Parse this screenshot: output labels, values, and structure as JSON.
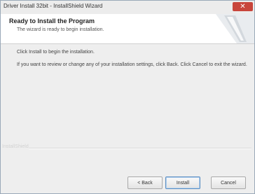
{
  "window": {
    "title": "Driver Install 32bit - InstallShield Wizard",
    "close_glyph": "✕"
  },
  "header": {
    "title": "Ready to Install the Program",
    "subtitle": "The wizard is ready to begin installation."
  },
  "body": {
    "line1": "Click Install to begin the installation.",
    "line2": "If you want to review or change any of your installation settings, click Back. Click Cancel to exit the wizard."
  },
  "footer": {
    "brand": "InstallShield",
    "back_label": "< Back",
    "install_label": "Install",
    "cancel_label": "Cancel"
  },
  "colors": {
    "close_button": "#c8453b",
    "default_button_border": "#5b8ec2"
  }
}
